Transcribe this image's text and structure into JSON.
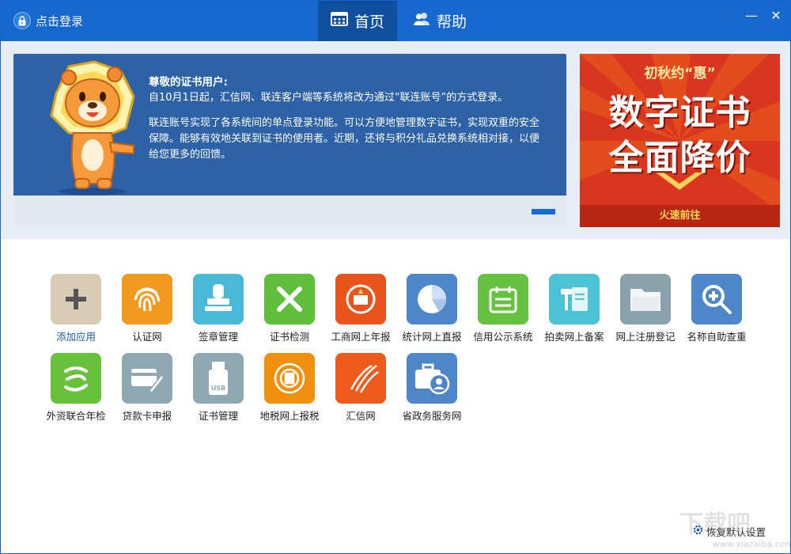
{
  "titlebar": {
    "login_label": "点击登录",
    "tabs": [
      {
        "label": "首页",
        "icon": "calendar-grid-icon",
        "active": true
      },
      {
        "label": "帮助",
        "icon": "users-icon",
        "active": false
      }
    ],
    "minimize_glyph": "—",
    "close_glyph": "✕"
  },
  "notice": {
    "greeting": "尊敬的证书用户:",
    "paragraph1": "自10月1日起，汇信网、联连客户端等系统将改为通过“联连账号”的方式登录。",
    "paragraph2": "联连账号实现了各系统间的单点登录功能。可以方便地管理数字证书，实现双重的安全保障。能够有效地关联到证书的使用者。近期，还将与积分礼品兑换系统相对接，以便给您更多的回馈。"
  },
  "promo": {
    "subtitle": "初秋约“惠”",
    "line1": "数字证书",
    "line2": "全面降价",
    "cta": "火速前往"
  },
  "apps": [
    {
      "label": "添加应用",
      "icon": "plus-icon",
      "color": "#d8ccb5"
    },
    {
      "label": "认证网",
      "icon": "fingerprint-icon",
      "color": "#f39a1e"
    },
    {
      "label": "签章管理",
      "icon": "stamp-icon",
      "color": "#49b9d5"
    },
    {
      "label": "证书检测",
      "icon": "tools-icon",
      "color": "#5fbf3a"
    },
    {
      "label": "工商网上年报",
      "icon": "emblem-icon",
      "color": "#e8541c"
    },
    {
      "label": "统计网上直报",
      "icon": "pie-chart-icon",
      "color": "#4f86c8"
    },
    {
      "label": "信用公示系统",
      "icon": "calendar-icon",
      "color": "#66c23f"
    },
    {
      "label": "拍卖网上备案",
      "icon": "gavel-icon",
      "color": "#4dc1d6"
    },
    {
      "label": "网上注册登记",
      "icon": "folder-icon",
      "color": "#8aa2ab"
    },
    {
      "label": "名称自助查重",
      "icon": "magnifier-icon",
      "color": "#4f86c8"
    },
    {
      "label": "外资联合年检",
      "icon": "swirl-icon",
      "color": "#69c23b"
    },
    {
      "label": "贷款卡申报",
      "icon": "card-pen-icon",
      "color": "#8ea9b4"
    },
    {
      "label": "证书管理",
      "icon": "usb-key-icon",
      "color": "#8ea9b4"
    },
    {
      "label": "地税网上报税",
      "icon": "tax-seal-icon",
      "color": "#f0900f"
    },
    {
      "label": "汇信网",
      "icon": "icinfo-logo-icon",
      "color": "#ee5a1a"
    },
    {
      "label": "省政务服务网",
      "icon": "briefcase-user-icon",
      "color": "#4f86c8"
    }
  ],
  "footer": {
    "reset_label": "恢复默认设置",
    "watermark": "下载吧",
    "watermark_url": "www.xiazaiba.com"
  }
}
